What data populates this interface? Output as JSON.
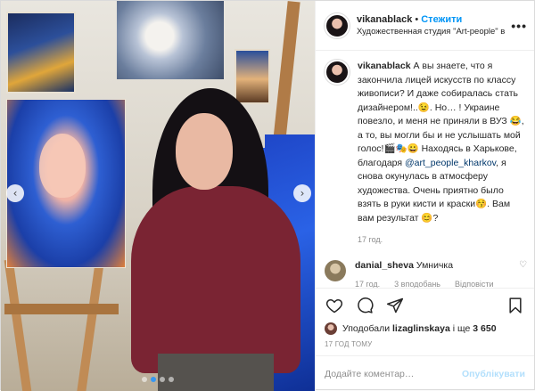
{
  "post": {
    "author": {
      "username": "vikanablack",
      "follow_label": "Стежити",
      "separator": "•",
      "location": "Художественная студия \"Art-people\" в Харько…"
    },
    "more_label": "•••",
    "carousel": {
      "prev_glyph": "‹",
      "next_glyph": "›",
      "slide_count": 4,
      "active_index": 1
    },
    "caption": {
      "username": "vikanablack",
      "text_part1": "А вы знаете, что я закончила лицей искусств по классу живописи? И даже собиралась стать дизайнером!..😉. Но… ! Украине повезло, и меня не приняли в ВУЗ 😂, а то, вы могли бы и не услышать мой голос!🎬🎭😀 Находясь в Харькове, благодаря ",
      "mention": "@art_people_kharkov",
      "text_part2": ", я снова окунулась в атмосферу художества. Очень приятно было взять в руки кисти и краски😚. Вам вам результат 😊?",
      "time": "17 год."
    },
    "comments": [
      {
        "username": "danial_sheva",
        "text": "Умничка",
        "time": "17 год.",
        "likes_label": "3 вподобань",
        "reply_label": "Відповісти",
        "heart_glyph": "♡"
      }
    ],
    "likes": {
      "prefix": "Уподобали",
      "user": "lizaglinskaya",
      "connector": "і ще",
      "count": "3 650"
    },
    "timestamp": "17 ГОД ТОМУ",
    "add_comment": {
      "placeholder": "Додайте коментар…",
      "publish_label": "Опублікувати"
    }
  },
  "colors": {
    "link_blue": "#0095f6",
    "publish_disabled": "#b2dffc",
    "muted_text": "#8e8e8e",
    "mention": "#00376b"
  }
}
